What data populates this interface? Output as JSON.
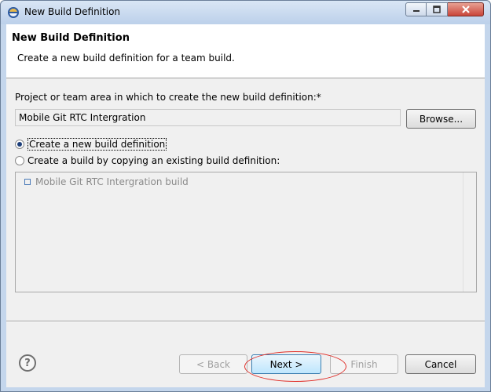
{
  "window": {
    "title": "New Build Definition",
    "icon": "eclipse-icon"
  },
  "header": {
    "title": "New Build Definition",
    "description": "Create a new build definition for a team build."
  },
  "project": {
    "label": "Project or team area in which to create the new build definition:*",
    "value": "Mobile Git RTC Intergration",
    "browse_label": "Browse..."
  },
  "options": {
    "create_new_label": "Create a new build definition",
    "copy_existing_label": "Create a build by copying an existing build definition:",
    "selected": "create_new"
  },
  "existing_builds": {
    "items": [
      {
        "label": "Mobile Git RTC Intergration build",
        "icon": "build-definition-icon"
      }
    ]
  },
  "buttons": {
    "back": "< Back",
    "next": "Next >",
    "finish": "Finish",
    "cancel": "Cancel"
  },
  "colors": {
    "annotation": "#e0302a",
    "accent": "#3c7fb1"
  }
}
